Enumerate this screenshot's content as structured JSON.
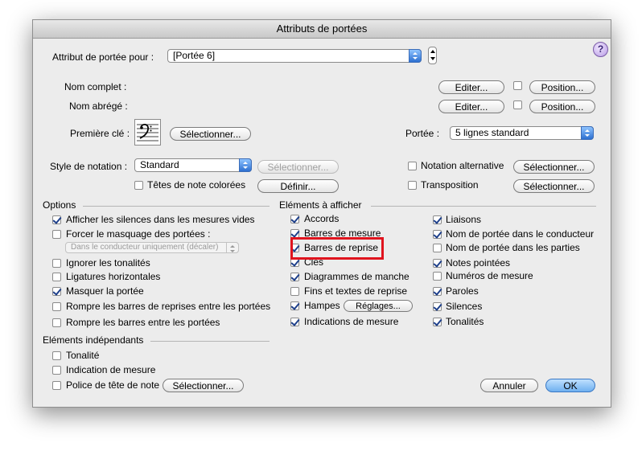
{
  "window": {
    "title": "Attributs de portées"
  },
  "top": {
    "attribut_label": "Attribut de portée pour :",
    "attribut_value": "[Portée 6]"
  },
  "names": {
    "nom_complet": "Nom complet :",
    "nom_abrege": "Nom abrégé :",
    "editer": "Editer...",
    "position": "Position..."
  },
  "cle": {
    "label": "Première clé :",
    "select": "Sélectionner...",
    "portee_label": "Portée :",
    "portee_value": "5 lignes standard"
  },
  "notation": {
    "style_label": "Style de notation :",
    "style_value": "Standard",
    "select_disabled": "Sélectionner...",
    "tetes_label": "Têtes de note colorées",
    "definir": "Définir...",
    "notation_alt": "Notation alternative",
    "transposition": "Transposition",
    "select": "Sélectionner..."
  },
  "options": {
    "title": "Options",
    "items": [
      {
        "label": "Afficher les silences dans les mesures vides",
        "checked": true
      },
      {
        "label": "Forcer le masquage des portées :",
        "checked": false
      },
      {
        "label": "Ignorer les tonalités",
        "checked": false
      },
      {
        "label": "Ligatures horizontales",
        "checked": false
      },
      {
        "label": "Masquer la portée",
        "checked": true
      },
      {
        "label": "Rompre les barres de reprises entre les portées",
        "checked": false
      },
      {
        "label": "Rompre les barres entre les portées",
        "checked": false
      }
    ],
    "masquage_popup": "Dans le conducteur uniquement (décaler)"
  },
  "elements": {
    "title": "Eléments à afficher",
    "col1": [
      {
        "label": "Accords",
        "checked": true
      },
      {
        "label": "Barres de mesure",
        "checked": true
      },
      {
        "label": "Barres de reprise",
        "checked": true
      },
      {
        "label": "Clés",
        "checked": true
      },
      {
        "label": "Diagrammes de manche",
        "checked": true
      },
      {
        "label": "Fins et textes de reprise",
        "checked": false
      },
      {
        "label": "Hampes",
        "checked": true
      },
      {
        "label": "Indications de mesure",
        "checked": true
      }
    ],
    "reglages": "Réglages...",
    "col2": [
      {
        "label": "Liaisons",
        "checked": true
      },
      {
        "label": "Nom de portée dans le conducteur",
        "checked": true
      },
      {
        "label": "Nom de portée dans les parties",
        "checked": false
      },
      {
        "label": "Notes pointées",
        "checked": true
      },
      {
        "label": "Numéros de mesure",
        "checked": false
      },
      {
        "label": "Paroles",
        "checked": true
      },
      {
        "label": "Silences",
        "checked": true
      },
      {
        "label": "Tonalités",
        "checked": true
      }
    ]
  },
  "independants": {
    "title": "Eléments indépendants",
    "items": [
      {
        "label": "Tonalité",
        "checked": false
      },
      {
        "label": "Indication de mesure",
        "checked": false
      },
      {
        "label": "Police de tête de note",
        "checked": false
      }
    ],
    "select": "Sélectionner..."
  },
  "footer": {
    "annuler": "Annuler",
    "ok": "OK"
  },
  "help": "?"
}
